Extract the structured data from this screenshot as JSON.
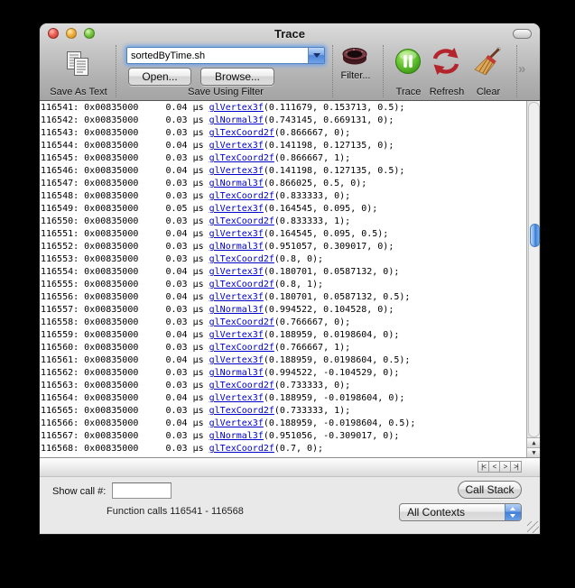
{
  "window": {
    "title": "Trace"
  },
  "toolbar": {
    "save_as_text_label": "Save As Text",
    "filter_combo_value": "sortedByTime.sh",
    "open_label": "Open...",
    "browse_label": "Browse...",
    "save_using_filter_label": "Save Using Filter",
    "filter_label": "Filter...",
    "trace_label": "Trace",
    "refresh_label": "Refresh",
    "clear_label": "Clear",
    "overflow_chevron": "»"
  },
  "trace_list": {
    "time_unit": "µs",
    "rows": [
      [
        "116541",
        "0x00835000",
        "0.04",
        "glVertex3f",
        "(0.111679, 0.153713, 0.5);"
      ],
      [
        "116542",
        "0x00835000",
        "0.03",
        "glNormal3f",
        "(0.743145, 0.669131, 0);"
      ],
      [
        "116543",
        "0x00835000",
        "0.03",
        "glTexCoord2f",
        "(0.866667, 0);"
      ],
      [
        "116544",
        "0x00835000",
        "0.04",
        "glVertex3f",
        "(0.141198, 0.127135, 0);"
      ],
      [
        "116545",
        "0x00835000",
        "0.03",
        "glTexCoord2f",
        "(0.866667, 1);"
      ],
      [
        "116546",
        "0x00835000",
        "0.04",
        "glVertex3f",
        "(0.141198, 0.127135, 0.5);"
      ],
      [
        "116547",
        "0x00835000",
        "0.03",
        "glNormal3f",
        "(0.866025, 0.5, 0);"
      ],
      [
        "116548",
        "0x00835000",
        "0.03",
        "glTexCoord2f",
        "(0.833333, 0);"
      ],
      [
        "116549",
        "0x00835000",
        "0.05",
        "glVertex3f",
        "(0.164545, 0.095, 0);"
      ],
      [
        "116550",
        "0x00835000",
        "0.03",
        "glTexCoord2f",
        "(0.833333, 1);"
      ],
      [
        "116551",
        "0x00835000",
        "0.04",
        "glVertex3f",
        "(0.164545, 0.095, 0.5);"
      ],
      [
        "116552",
        "0x00835000",
        "0.03",
        "glNormal3f",
        "(0.951057, 0.309017, 0);"
      ],
      [
        "116553",
        "0x00835000",
        "0.03",
        "glTexCoord2f",
        "(0.8, 0);"
      ],
      [
        "116554",
        "0x00835000",
        "0.04",
        "glVertex3f",
        "(0.180701, 0.0587132, 0);"
      ],
      [
        "116555",
        "0x00835000",
        "0.03",
        "glTexCoord2f",
        "(0.8, 1);"
      ],
      [
        "116556",
        "0x00835000",
        "0.04",
        "glVertex3f",
        "(0.180701, 0.0587132, 0.5);"
      ],
      [
        "116557",
        "0x00835000",
        "0.03",
        "glNormal3f",
        "(0.994522, 0.104528, 0);"
      ],
      [
        "116558",
        "0x00835000",
        "0.03",
        "glTexCoord2f",
        "(0.766667, 0);"
      ],
      [
        "116559",
        "0x00835000",
        "0.04",
        "glVertex3f",
        "(0.188959, 0.0198604, 0);"
      ],
      [
        "116560",
        "0x00835000",
        "0.03",
        "glTexCoord2f",
        "(0.766667, 1);"
      ],
      [
        "116561",
        "0x00835000",
        "0.04",
        "glVertex3f",
        "(0.188959, 0.0198604, 0.5);"
      ],
      [
        "116562",
        "0x00835000",
        "0.03",
        "glNormal3f",
        "(0.994522, -0.104529, 0);"
      ],
      [
        "116563",
        "0x00835000",
        "0.03",
        "glTexCoord2f",
        "(0.733333, 0);"
      ],
      [
        "116564",
        "0x00835000",
        "0.04",
        "glVertex3f",
        "(0.188959, -0.0198604, 0);"
      ],
      [
        "116565",
        "0x00835000",
        "0.03",
        "glTexCoord2f",
        "(0.733333, 1);"
      ],
      [
        "116566",
        "0x00835000",
        "0.04",
        "glVertex3f",
        "(0.188959, -0.0198604, 0.5);"
      ],
      [
        "116567",
        "0x00835000",
        "0.03",
        "glNormal3f",
        "(0.951056, -0.309017, 0);"
      ],
      [
        "116568",
        "0x00835000",
        "0.03",
        "glTexCoord2f",
        "(0.7, 0);"
      ]
    ]
  },
  "pager": {
    "buttons": [
      {
        "label": "|<"
      },
      {
        "label": "<"
      },
      {
        "label": ">"
      },
      {
        "label": ">|"
      }
    ]
  },
  "footer": {
    "show_call_label": "Show call #:",
    "show_call_value": "",
    "call_stack_label": "Call Stack",
    "status": "Function calls 116541 - 116568",
    "context_selector_value": "All Contexts"
  },
  "colors": {
    "link_blue": "#0000cd",
    "trace_green": "#55b224",
    "refresh_red": "#b3242c",
    "aqua_blue": "#3f7ed6",
    "list_bg": "#ffffff",
    "footer_bg": "#e9e9e9"
  }
}
